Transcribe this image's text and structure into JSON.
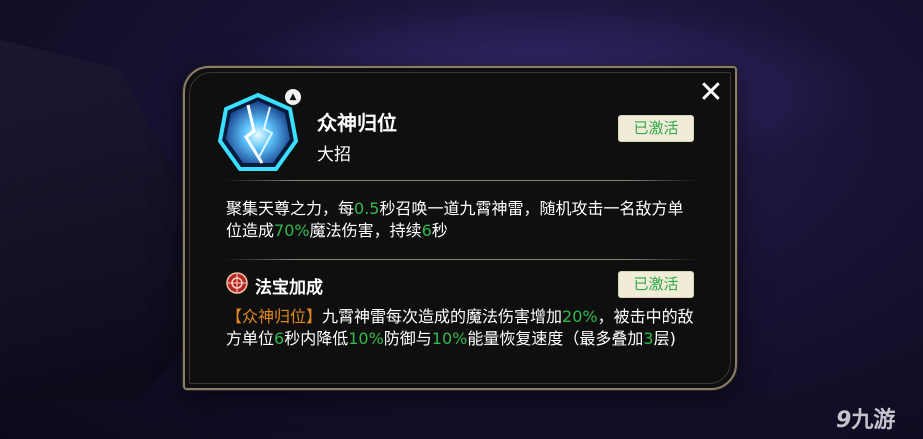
{
  "skill": {
    "name": "众神归位",
    "type": "大招",
    "status": "已激活",
    "desc": [
      {
        "t": "聚集天尊之力，每",
        "c": "n"
      },
      {
        "t": "0.5",
        "c": "hl"
      },
      {
        "t": "秒召唤一道九霄神雷，随机攻击一名敌方单位造成",
        "c": "n"
      },
      {
        "t": "70%",
        "c": "hl"
      },
      {
        "t": "魔法伤害，持续",
        "c": "n"
      },
      {
        "t": "6",
        "c": "hl"
      },
      {
        "t": "秒",
        "c": "n"
      }
    ]
  },
  "treasure": {
    "title": "法宝加成",
    "status": "已激活",
    "desc": [
      {
        "t": "【众神归位】",
        "c": "tag"
      },
      {
        "t": "九霄神雷每次造成的魔法伤害增加",
        "c": "n"
      },
      {
        "t": "20%",
        "c": "hl"
      },
      {
        "t": "，被击中的敌方单位",
        "c": "n"
      },
      {
        "t": "6",
        "c": "hl"
      },
      {
        "t": "秒内降低",
        "c": "n"
      },
      {
        "t": "10%",
        "c": "hl"
      },
      {
        "t": "防御与",
        "c": "n"
      },
      {
        "t": "10%",
        "c": "hl"
      },
      {
        "t": "能量恢复速度（最多叠加",
        "c": "n"
      },
      {
        "t": "3",
        "c": "hl"
      },
      {
        "t": "层)",
        "c": "n"
      }
    ]
  },
  "icons": {
    "close": "close-icon",
    "skill": "lightning-skill-icon",
    "upgrade": "upgrade-arrow-icon",
    "treasure": "treasure-seal-icon"
  },
  "colors": {
    "highlight": "#33b84a",
    "tag": "#e08a1e",
    "badge_bg": "#f0ecd7",
    "badge_text": "#2ea94b",
    "panel_bg": "#100f10",
    "panel_border": "#8a7e6a"
  },
  "watermark": {
    "glyph": "9",
    "text": "九游"
  }
}
